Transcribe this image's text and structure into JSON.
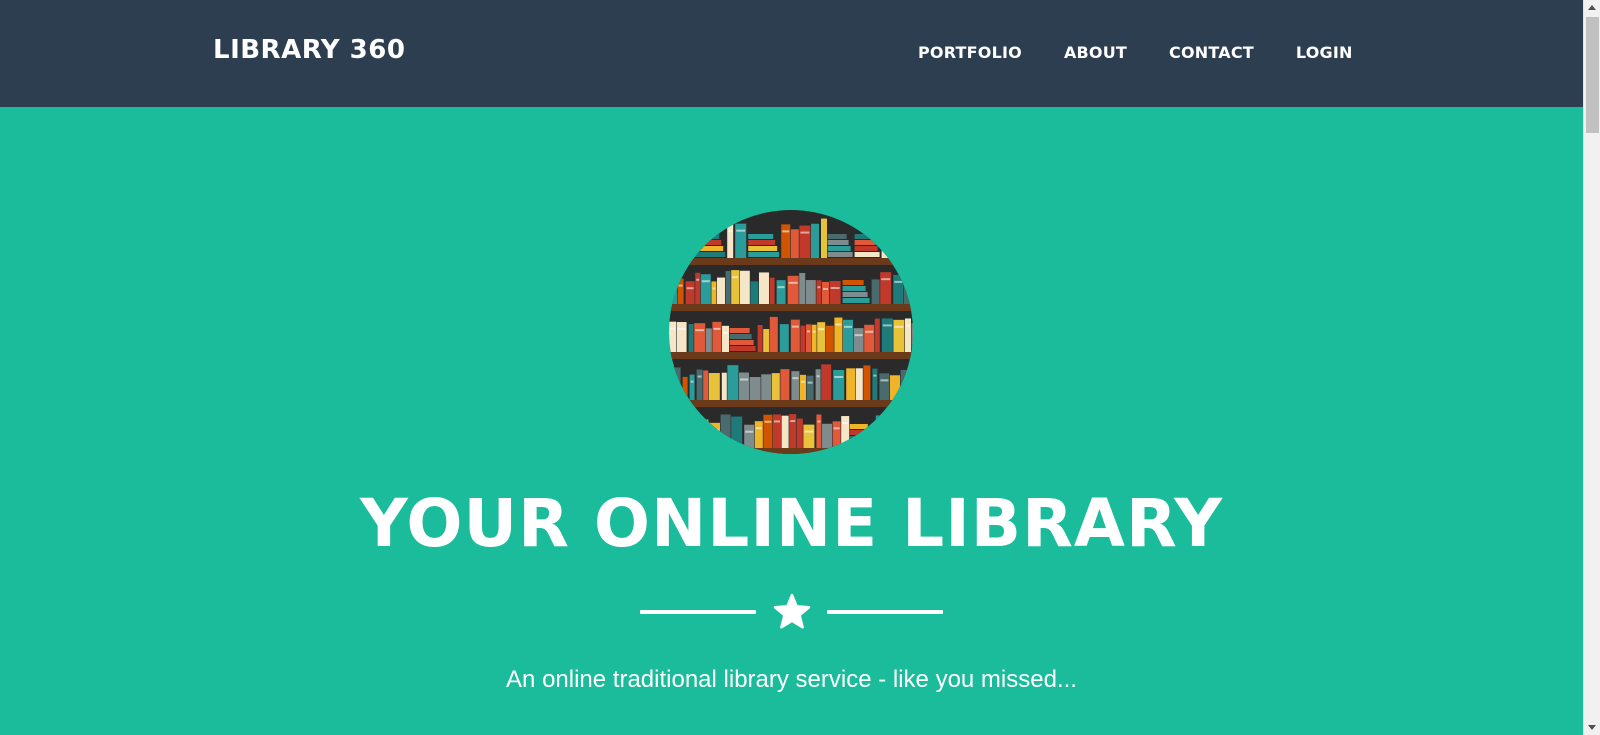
{
  "navbar": {
    "brand": "LIBRARY 360",
    "links": [
      {
        "label": "PORTFOLIO"
      },
      {
        "label": "ABOUT"
      },
      {
        "label": "CONTACT"
      },
      {
        "label": "LOGIN"
      }
    ]
  },
  "masthead": {
    "avatar_icon": "bookshelf-illustration",
    "title": "YOUR ONLINE LIBRARY",
    "divider_icon": "star-icon",
    "subheading": "An online traditional library service - like you missed..."
  },
  "colors": {
    "navbar_bg": "#2c3e50",
    "primary": "#1abc9c",
    "text": "#ffffff",
    "shelf": "#6b3a1a",
    "shelf_bg": "#2a2a2a"
  }
}
